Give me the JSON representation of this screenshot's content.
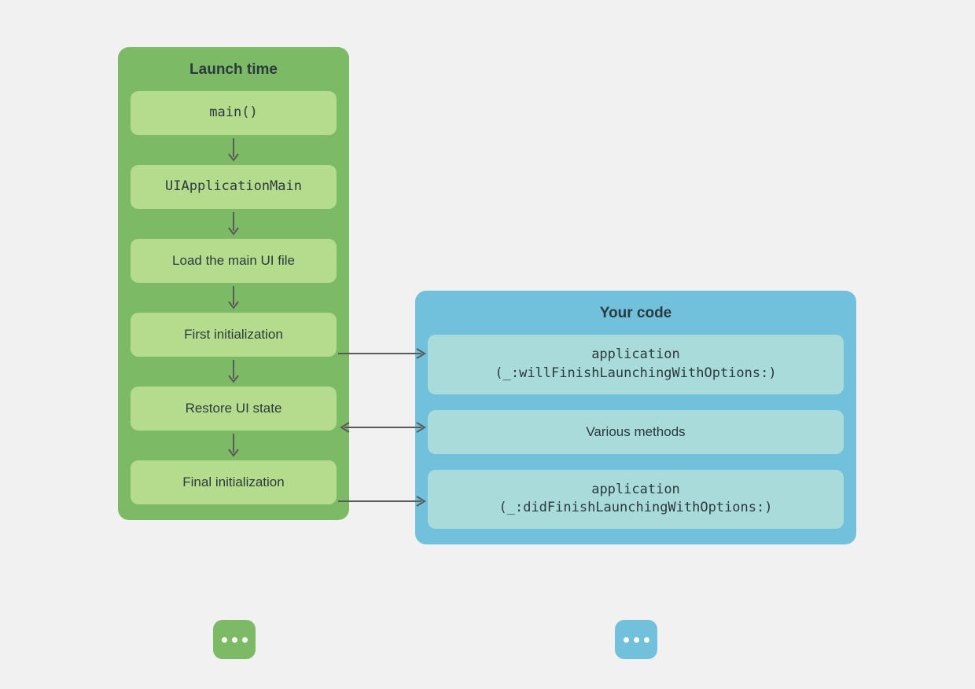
{
  "launch_panel": {
    "title": "Launch time",
    "steps": [
      "main()",
      "UIApplicationMain",
      "Load the main UI file",
      "First initialization",
      "Restore UI state",
      "Final initialization"
    ]
  },
  "code_panel": {
    "title": "Your code",
    "items": [
      "application\n(_:willFinishLaunchingWithOptions:)",
      "Various methods",
      "application\n(_:didFinishLaunchingWithOptions:)"
    ]
  }
}
